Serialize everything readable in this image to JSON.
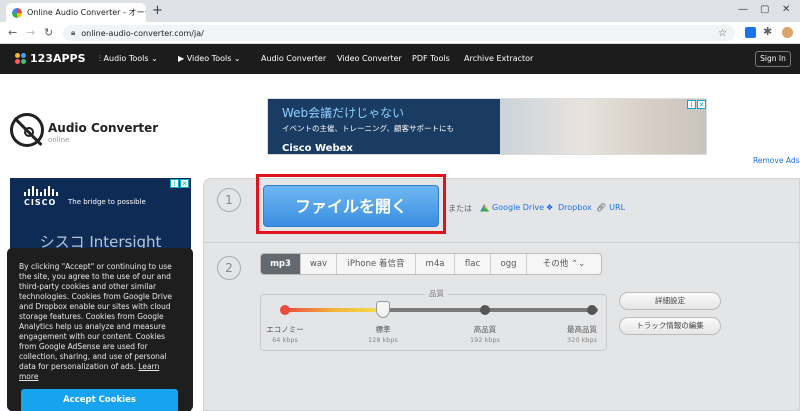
{
  "browser": {
    "tab_title": "Online Audio Converter - オーディ",
    "tab_close": "✕",
    "new_tab": "+",
    "url": "online-audio-converter.com/ja/",
    "window_controls": [
      "—",
      "▢",
      "✕"
    ]
  },
  "site_nav": {
    "logo": "123APPS",
    "items": [
      "Audio Tools ⌄",
      "Video Tools ⌄",
      "Audio Converter",
      "Video Converter",
      "PDF Tools",
      "Archive Extractor"
    ],
    "signin": "Sign In"
  },
  "brand": {
    "title": "Audio Converter",
    "subtitle": "online"
  },
  "top_ad": {
    "headline": "Web会議だけじゃない",
    "subline": "イベントの主催、トレーニング、顧客サポートにも",
    "logo": "Cisco Webex"
  },
  "remove_ads": "Remove Ads",
  "side_ad": {
    "brand": "CISCO",
    "tagline": "The bridge to possible",
    "big_text": "シスコ Intersight"
  },
  "cookie": {
    "text": "By clicking \"Accept\" or continuing to use the site, you agree to the use of our and third-party cookies and other similar technologies. Cookies from Google Drive and Dropbox enable our sites with cloud storage features. Cookies from Google Analytics help us analyze and measure engagement with our content. Cookies from Google AdSense are used for collection, sharing, and use of personal data for personalization of ads.",
    "learn_more": "Learn more",
    "accept": "Accept Cookies"
  },
  "step1": {
    "number": "1",
    "open_button": "ファイルを開く",
    "or_label": "または",
    "sources": [
      "Google Drive",
      "Dropbox",
      "URL"
    ]
  },
  "step2": {
    "number": "2",
    "formats": [
      "mp3",
      "wav",
      "iPhone 着信音",
      "m4a",
      "flac",
      "ogg",
      "その他 ⌃⌄"
    ],
    "active_format": "mp3",
    "quality_label": "品質",
    "quality_levels": [
      {
        "name": "エコノミー",
        "kbps": "64 kbps"
      },
      {
        "name": "標準",
        "kbps": "128 kbps"
      },
      {
        "name": "高品質",
        "kbps": "192 kbps"
      },
      {
        "name": "最高品質",
        "kbps": "320 kbps"
      }
    ],
    "selected_quality_index": 1,
    "advanced_button": "詳細設定",
    "track_info_button": "トラック情報の編集"
  },
  "colors": {
    "highlight": "#e0121b",
    "button_blue": "#3a8fe0",
    "cookie_accept": "#18a3ee"
  }
}
